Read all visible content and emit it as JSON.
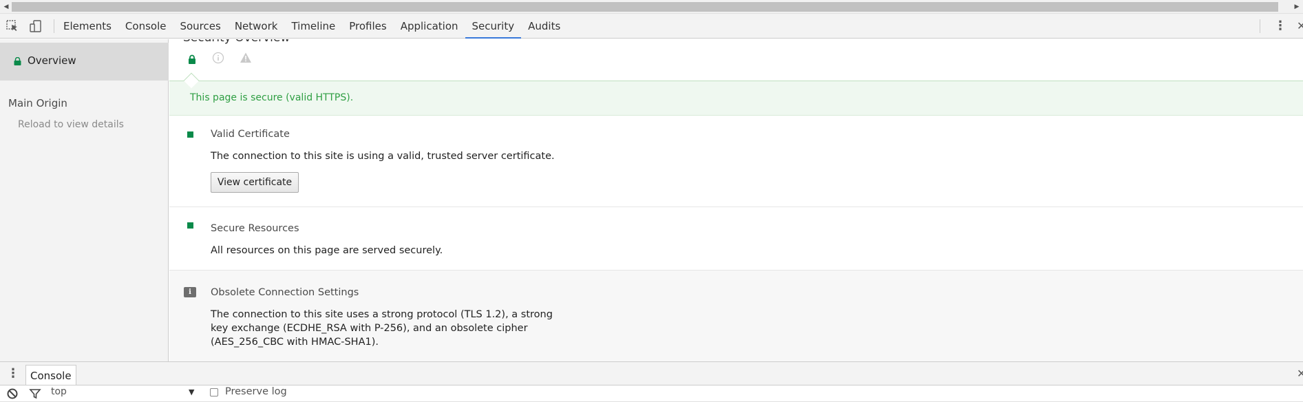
{
  "tabbar": {
    "tabs": [
      {
        "label": "Elements"
      },
      {
        "label": "Console"
      },
      {
        "label": "Sources"
      },
      {
        "label": "Network"
      },
      {
        "label": "Timeline"
      },
      {
        "label": "Profiles"
      },
      {
        "label": "Application"
      },
      {
        "label": "Security",
        "active": true
      },
      {
        "label": "Audits"
      }
    ],
    "icons": [
      "inspect-element-icon",
      "device-mode-icon",
      "more-options-icon",
      "close-icon"
    ]
  },
  "sidebar": {
    "overview_label": "Overview",
    "main_origin_label": "Main Origin",
    "reload_hint": "Reload to view details"
  },
  "main": {
    "title": "Security Overview",
    "filter_icons": [
      "lock-icon",
      "info-circle-icon",
      "warning-triangle-icon"
    ],
    "secure_banner": "This page is secure (valid HTTPS).",
    "sections": [
      {
        "title": "Valid Certificate",
        "description": "The connection to this site is using a valid, trusted server certificate.",
        "button": "View certificate",
        "status": "secure"
      },
      {
        "title": "Secure Resources",
        "description": "All resources on this page are served securely.",
        "status": "secure"
      },
      {
        "title": "Obsolete Connection Settings",
        "description": "The connection to this site uses a strong protocol (TLS 1.2), a strong key exchange (ECDHE_RSA with P-256), and an obsolete cipher (AES_256_CBC with HMAC-SHA1).",
        "status": "info"
      }
    ]
  },
  "drawer": {
    "tab_label": "Console",
    "context_value": "top",
    "preserve_log_label": "Preserve log",
    "preserve_log_checked": false
  },
  "colors": {
    "accent": "#3879d9",
    "secure_green": "#0a8a4a",
    "banner_text": "#2e9e42",
    "banner_bg": "#eff8f0"
  }
}
